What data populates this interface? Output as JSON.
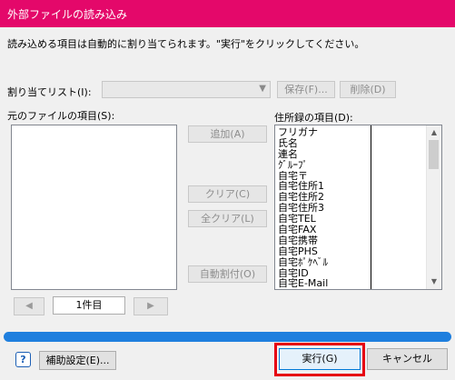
{
  "window": {
    "title": "外部ファイルの読み込み"
  },
  "instruction": "読み込める項目は自動的に割り当てられます。\"実行\"をクリックしてください。",
  "assign_list": {
    "label": "割り当てリスト(I):",
    "selected": "",
    "save_label": "保存(F)...",
    "delete_label": "削除(D)"
  },
  "source": {
    "label": "元のファイルの項目(S):",
    "items": [],
    "page_label": "1件目"
  },
  "middle_buttons": {
    "add": "追加(A)",
    "clear": "クリア(C)",
    "clear_all": "全クリア(L)",
    "auto_assign": "自動割付(O)"
  },
  "address_fields": {
    "label": "住所録の項目(D):",
    "items": [
      "フリガナ",
      "氏名",
      "連名",
      "ｸﾞﾙｰﾌﾟ",
      "自宅〒",
      "自宅住所1",
      "自宅住所2",
      "自宅住所3",
      "自宅TEL",
      "自宅FAX",
      "自宅携帯",
      "自宅PHS",
      "自宅ﾎﾟｹﾍﾞﾙ",
      "自宅ID",
      "自宅E-Mail"
    ]
  },
  "progress": {
    "value": 1.0,
    "color": "#1f7fde"
  },
  "footer": {
    "help_glyph": "?",
    "aux_settings": "補助設定(E)...",
    "execute": "実行(G)",
    "cancel": "キャンセル"
  },
  "colors": {
    "titlebar": "#e4086a",
    "highlight": "#e60012"
  }
}
